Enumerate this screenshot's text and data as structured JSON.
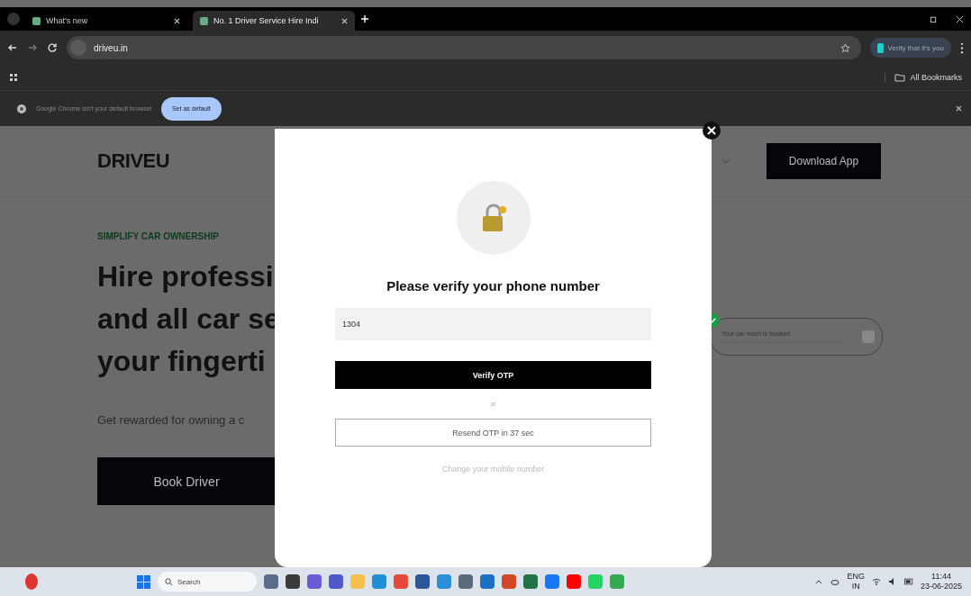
{
  "browser": {
    "tabs": [
      {
        "title": "What's new",
        "selected": false
      },
      {
        "title": "No. 1 Driver Service Hire Indi",
        "selected": true
      }
    ],
    "address": "driveu.in",
    "profile_chip": "Verify that it's you",
    "bookmarks_folder": "All Bookmarks",
    "banner": {
      "message": "Google Chrome isn't your default browser",
      "button": "Set as default"
    }
  },
  "page": {
    "logo": "DRIVEU",
    "download_button": "Download App",
    "tagline": "SIMPLIFY CAR OWNERSHIP",
    "headline": [
      "Hire professi",
      "and all car se",
      "your fingerti"
    ],
    "subtext": "Get rewarded for owning a c",
    "book_button": "Book Driver",
    "notification": "Your car wash is booked"
  },
  "modal": {
    "title": "Please verify your phone number",
    "otp_value": "1304",
    "verify_button": "Verify OTP",
    "separator": "or",
    "resend_button": "Resend OTP in 37 sec",
    "change_link": "Change your mobile number"
  },
  "taskbar": {
    "search_placeholder": "Search",
    "language": [
      "ENG",
      "IN"
    ],
    "time": "11:44",
    "date": "23-06-2025"
  }
}
